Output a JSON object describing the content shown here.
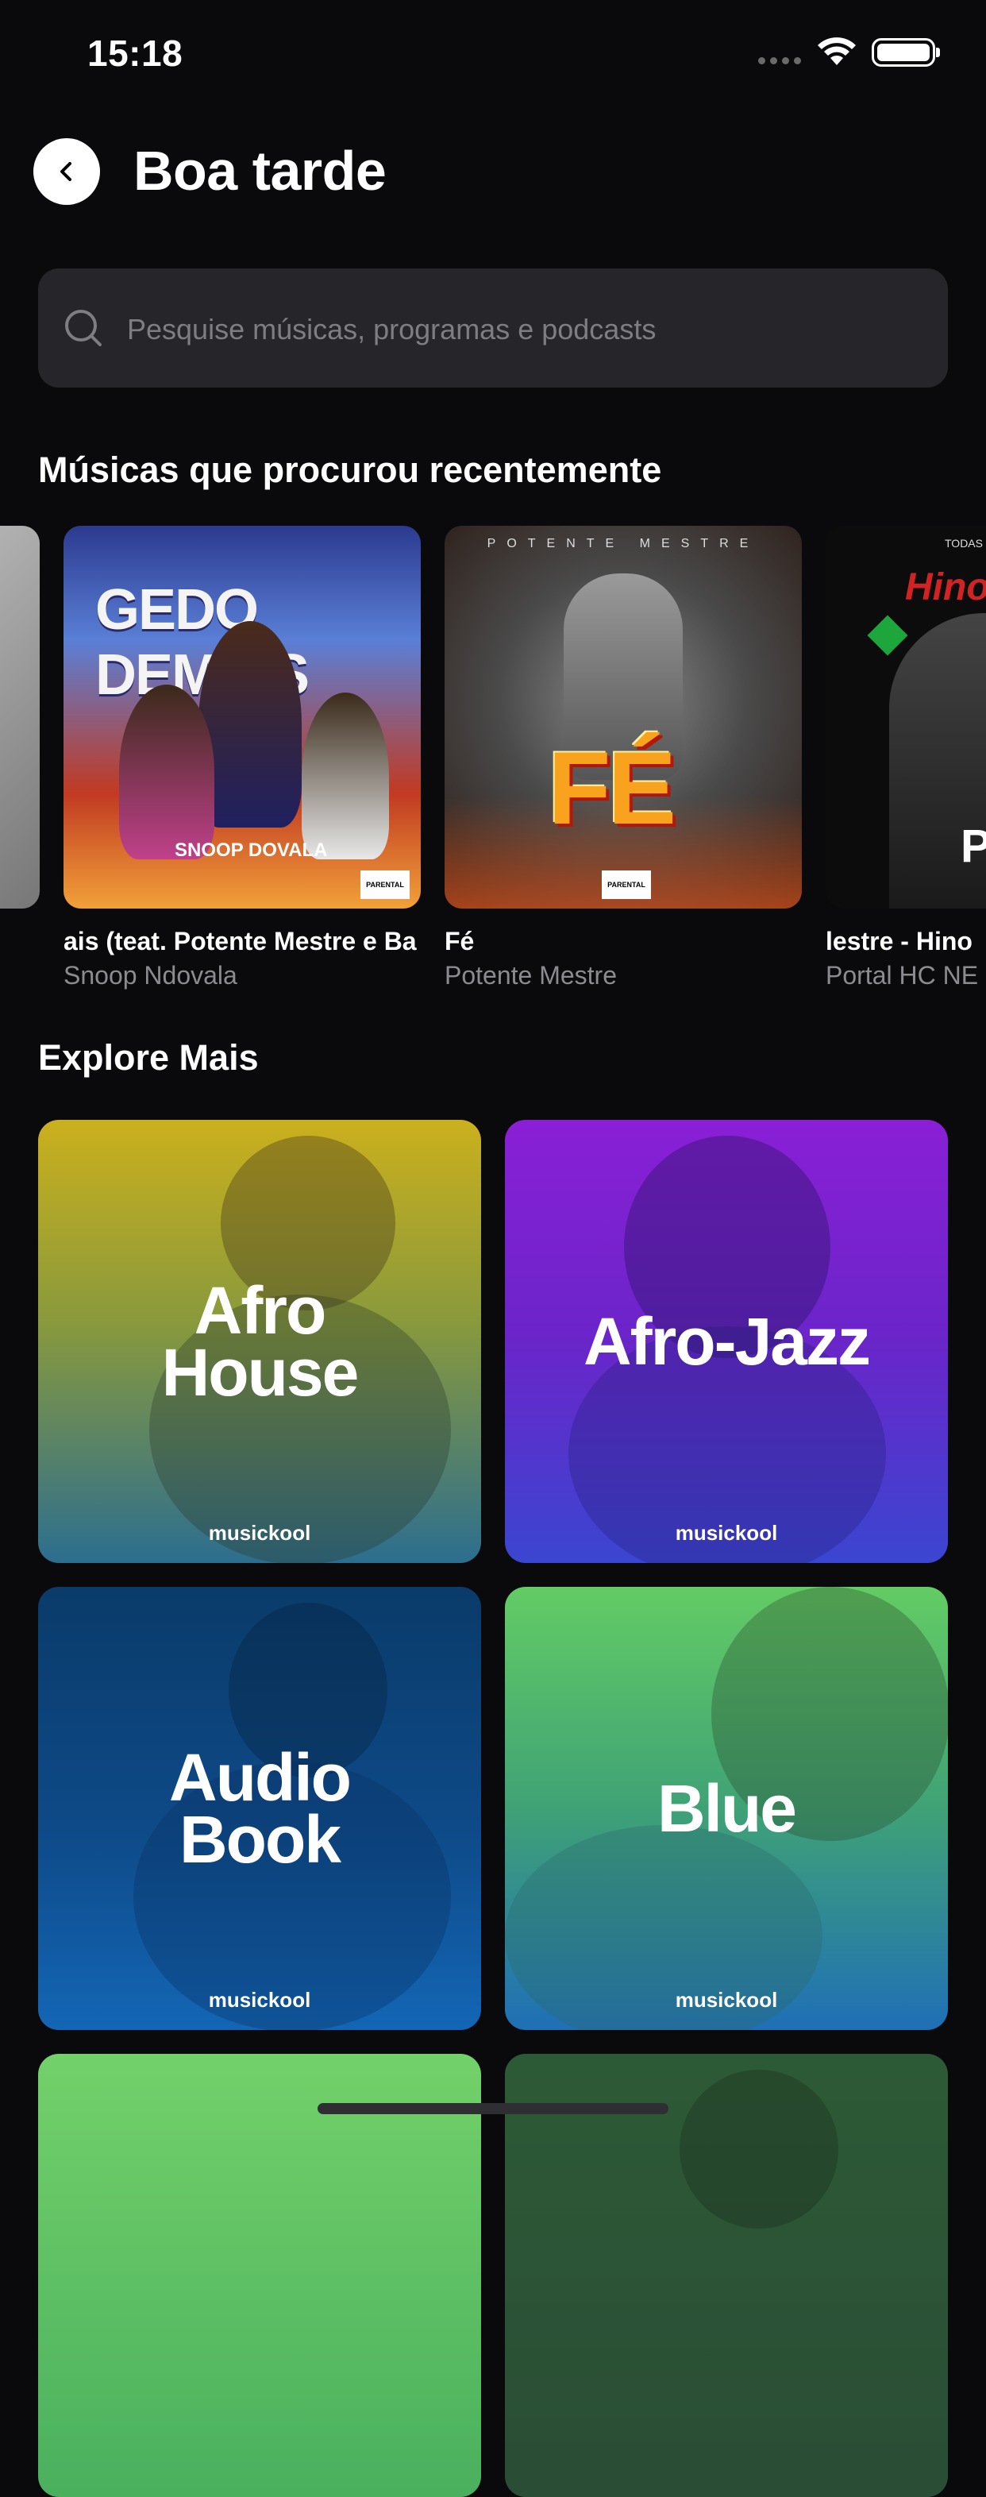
{
  "status_bar": {
    "time": "15:18"
  },
  "header": {
    "title": "Boa tarde"
  },
  "search": {
    "placeholder": "Pesquise músicas, programas e podcasts"
  },
  "recent": {
    "heading": "Músicas que procurou recentemente",
    "items": [
      {
        "title": "",
        "artist": ""
      },
      {
        "title": "ais (teat. Potente Mestre e Ba",
        "artist": "Snoop Ndovala",
        "cover_text": "GEDO DEMAIS",
        "cover_label": "SNOOP DOVALA"
      },
      {
        "title": "Fé",
        "artist": "Potente Mestre",
        "cover_text": "FÉ",
        "cover_top": "POTENTE MESTRE"
      },
      {
        "title": "lestre  - Hino",
        "artist": "Portal HC NE",
        "cover_top": "TODAS BA",
        "cover_red": "Hino D",
        "cover_text": "PO ME"
      }
    ]
  },
  "explore": {
    "heading": "Explore Mais",
    "brand": "musickool",
    "tiles": [
      {
        "name": "Afro\nHouse"
      },
      {
        "name": "Afro-Jazz"
      },
      {
        "name": "Audio\nBook"
      },
      {
        "name": "Blue"
      },
      {
        "name": ""
      },
      {
        "name": ""
      }
    ]
  },
  "colors": {
    "background": "#0a0a0c",
    "search_bg": "#26262a",
    "muted_text": "#8b8b90",
    "afro_house": "#cbb01d",
    "afro_jazz": "#8a1fd6",
    "audio_book": "#0e4a88",
    "blue": "#63cc64"
  }
}
